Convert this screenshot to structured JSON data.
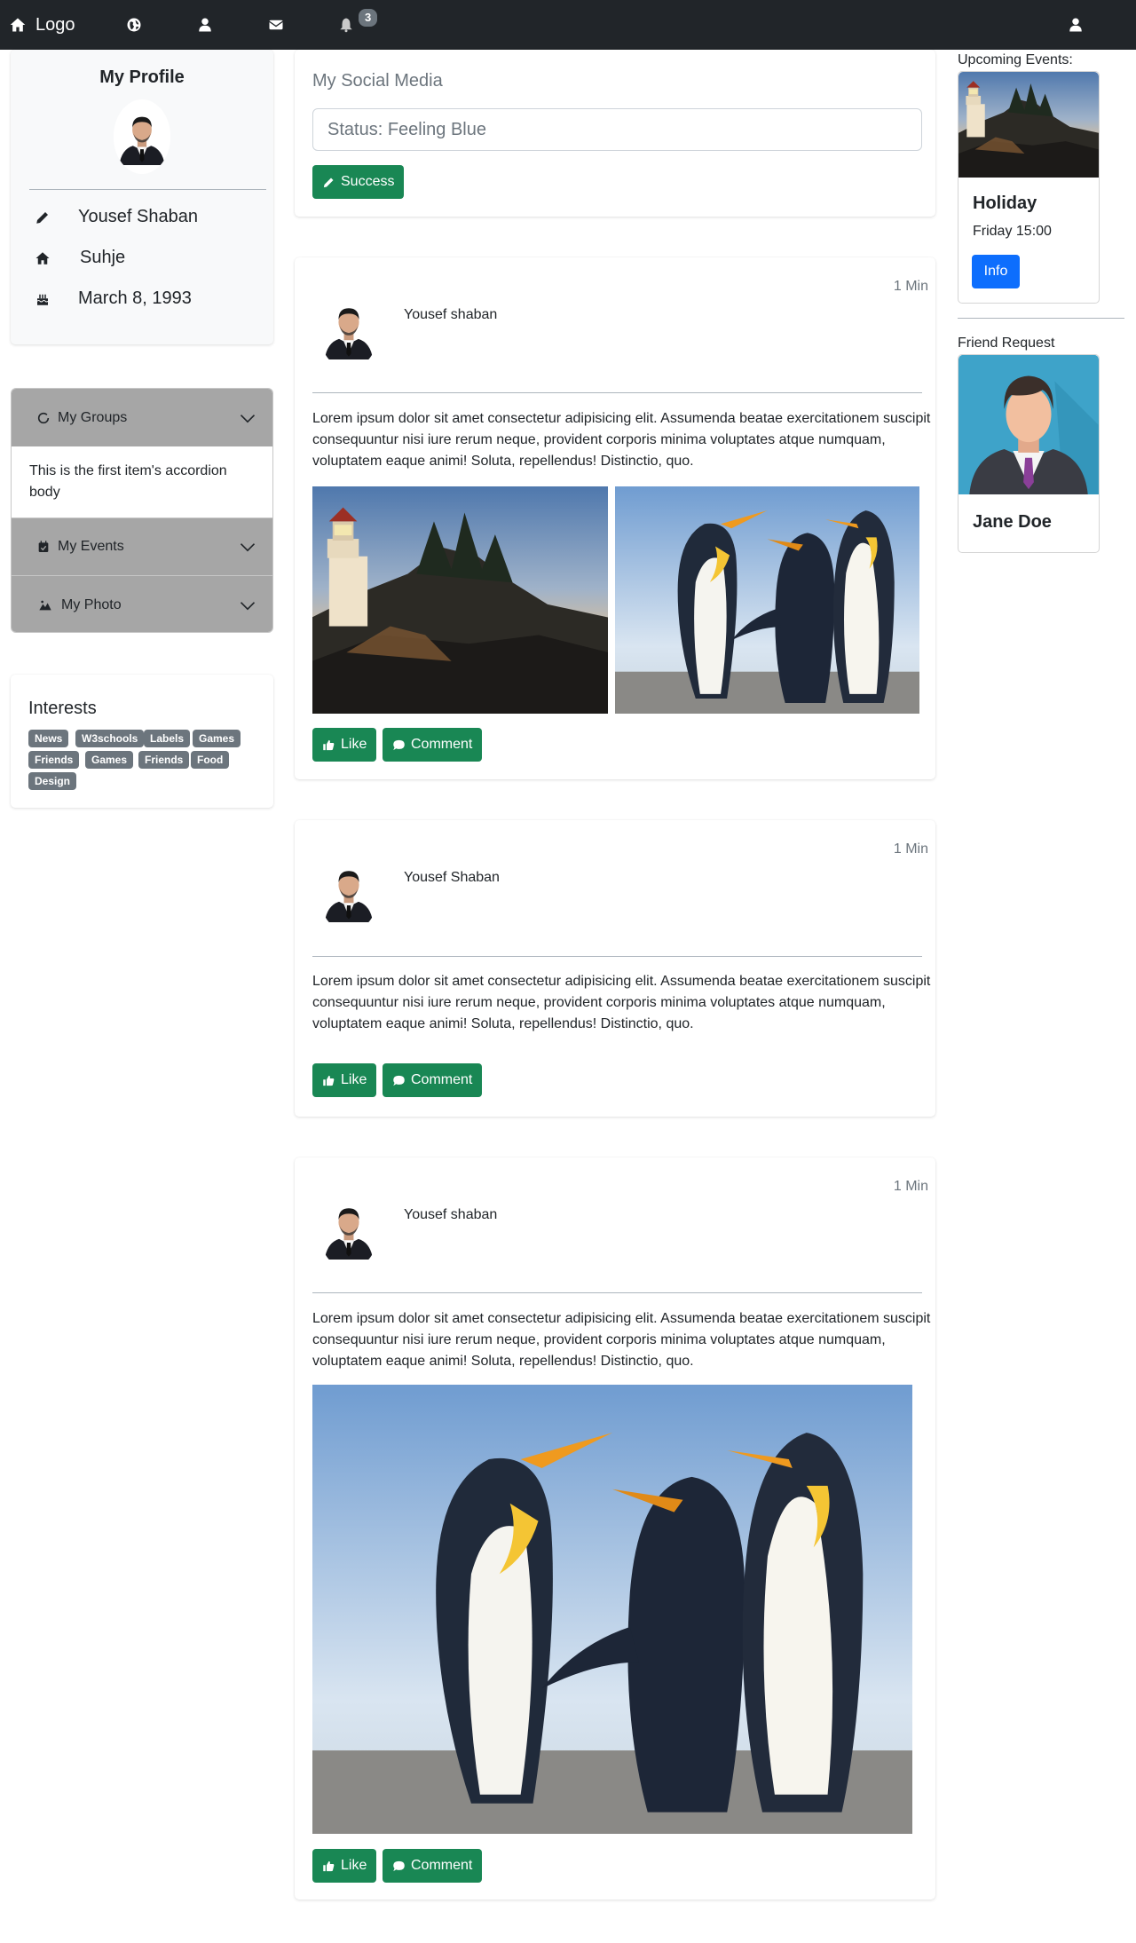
{
  "navbar": {
    "brand": "Logo",
    "notification_count": "3"
  },
  "profile": {
    "title": "My Profile",
    "name": "Yousef Shaban",
    "location": "Suhje",
    "birthday": "March 8, 1993"
  },
  "accordion": {
    "items": [
      {
        "label": "My Groups",
        "icon": "circle-notch-icon",
        "expanded": true,
        "body": "This is the first item's accordion body"
      },
      {
        "label": "My Events",
        "icon": "calendar-check-icon",
        "expanded": false
      },
      {
        "label": "My Photo",
        "icon": "camera-retro-icon",
        "expanded": false
      }
    ]
  },
  "interests": {
    "title": "Interests",
    "tags": [
      "News",
      "W3schools",
      "Labels",
      "Games",
      "Friends",
      "Games",
      "Friends",
      "Food",
      "Design"
    ]
  },
  "status_box": {
    "title": "My Social Media",
    "input_value": "Status: Feeling Blue",
    "button_label": "Success"
  },
  "posts": [
    {
      "author": "Yousef shaban",
      "time": "1 Min",
      "text": "Lorem ipsum dolor sit amet consectetur adipisicing elit. Assumenda beatae exercitationem suscipit consequuntur nisi iure rerum neque, provident corporis minima voluptates atque numquam, voluptatem eaque animi! Soluta, repellendus! Distinctio, quo.",
      "like_label": "Like",
      "comment_label": "Comment"
    },
    {
      "author": "Yousef Shaban",
      "time": "1 Min",
      "text": "Lorem ipsum dolor sit amet consectetur adipisicing elit. Assumenda beatae exercitationem suscipit consequuntur nisi iure rerum neque, provident corporis minima voluptates atque numquam, voluptatem eaque animi! Soluta, repellendus! Distinctio, quo.",
      "like_label": "Like",
      "comment_label": "Comment"
    },
    {
      "author": "Yousef shaban",
      "time": "1 Min",
      "text": "Lorem ipsum dolor sit amet consectetur adipisicing elit. Assumenda beatae exercitationem suscipit consequuntur nisi iure rerum neque, provident corporis minima voluptates atque numquam, voluptatem eaque animi! Soluta, repellendus! Distinctio, quo.",
      "like_label": "Like",
      "comment_label": "Comment"
    }
  ],
  "events": {
    "heading": "Upcoming Events:",
    "title": "Holiday",
    "time": "Friday 15:00",
    "button_label": "Info"
  },
  "friend_request": {
    "heading": "Friend Request",
    "name": "Jane Doe"
  },
  "colors": {
    "navbar": "#212529",
    "success": "#198754",
    "primary": "#0d6efd",
    "badge": "#6c757d",
    "accordion_header": "#a6a6a6"
  }
}
